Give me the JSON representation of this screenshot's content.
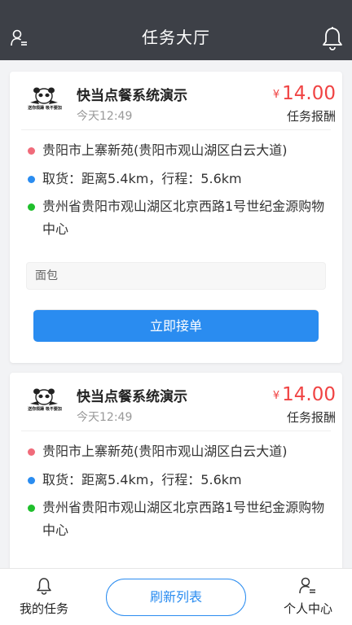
{
  "header": {
    "title": "任务大厅"
  },
  "orders": [
    {
      "shop_name": "快当点餐系统演示",
      "time": "今天12:49",
      "currency": "¥",
      "price": "14.00",
      "reward_label": "任务报酬",
      "pickup": "贵阳市上寨新苑(贵阳市观山湖区白云大道)",
      "distance": "取货：距离5.4km，行程：5.6km",
      "dropoff": "贵州省贵阳市观山湖区北京西路1号世纪金源购物中心",
      "note": "面包",
      "accept_label": "立即接单",
      "logo_caption": "送你烦躁 吸不要加"
    },
    {
      "shop_name": "快当点餐系统演示",
      "time": "今天12:49",
      "currency": "¥",
      "price": "14.00",
      "reward_label": "任务报酬",
      "pickup": "贵阳市上寨新苑(贵阳市观山湖区白云大道)",
      "distance": "取货：距离5.4km，行程：5.6km",
      "dropoff": "贵州省贵阳市观山湖区北京西路1号世纪金源购物中心",
      "logo_caption": "送你烦躁 吸不要加"
    }
  ],
  "bottom_bar": {
    "my_tasks_label": "我的任务",
    "refresh_label": "刷新列表",
    "profile_label": "个人中心"
  },
  "colors": {
    "header_bg": "#3d4047",
    "accent": "#2a8cf0",
    "price": "#f04343",
    "pickup_dot": "#f06b7a",
    "distance_dot": "#2a8cf0",
    "dropoff_dot": "#1fbf2c"
  },
  "icons": {
    "header_left": "user-list-icon",
    "header_right": "bell-icon",
    "tab_left": "bell-icon",
    "tab_right": "user-list-icon"
  }
}
